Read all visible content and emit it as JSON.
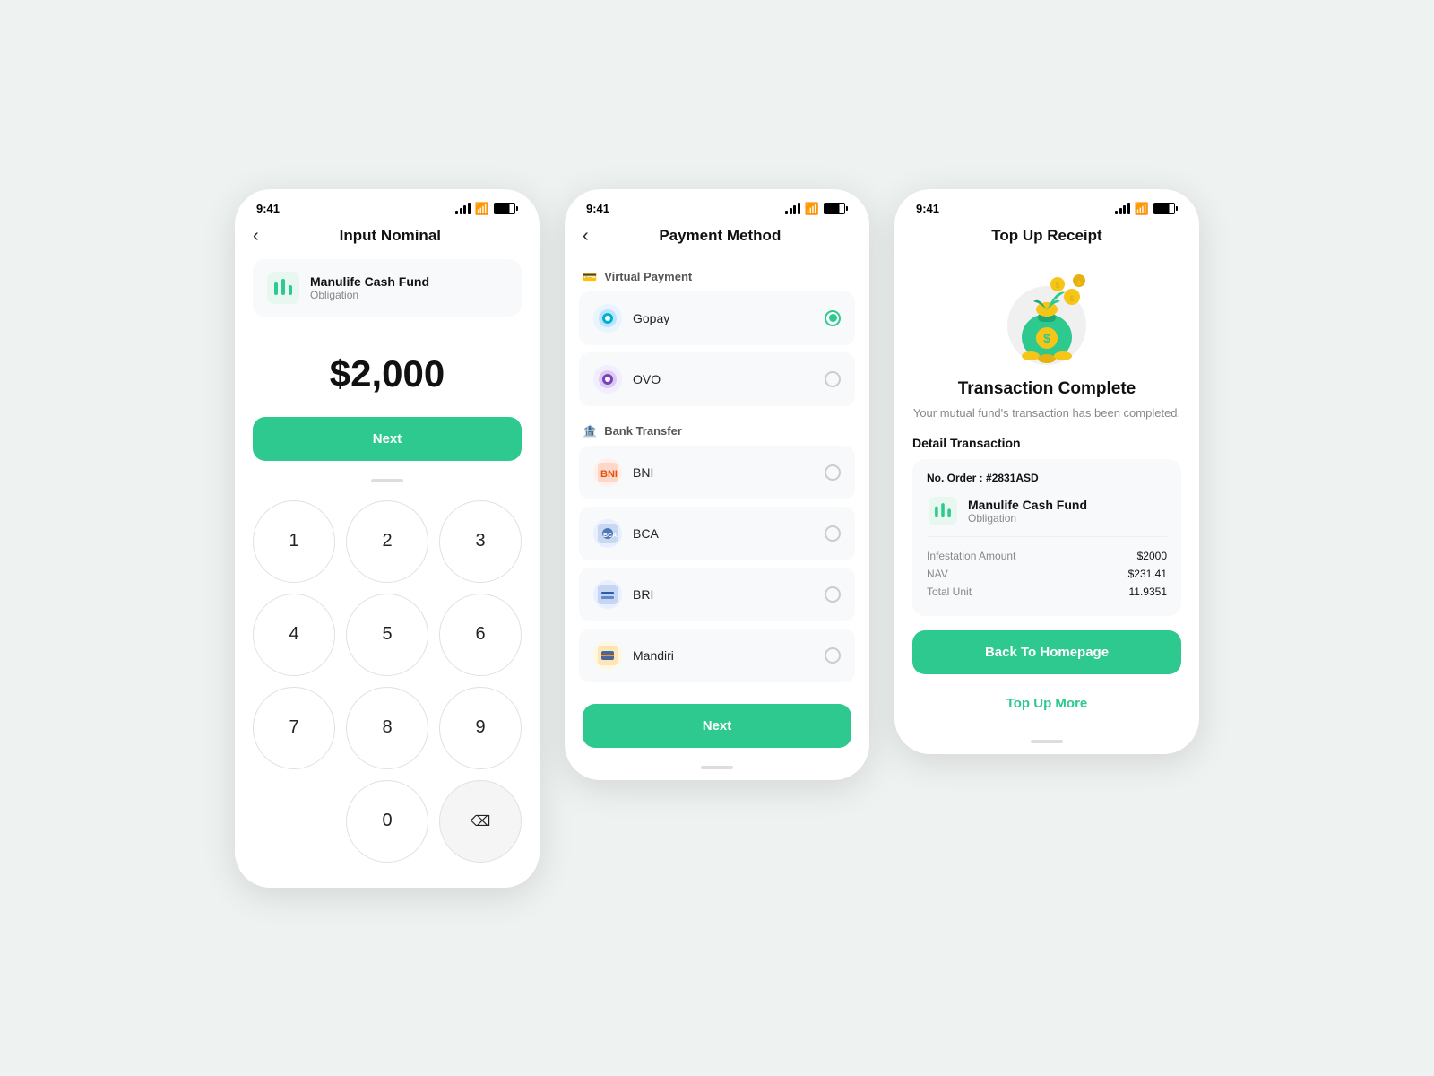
{
  "screens": {
    "screen1": {
      "time": "9:41",
      "title": "Input Nominal",
      "fund_name": "Manulife Cash Fund",
      "fund_type": "Obligation",
      "amount": "$2,000",
      "next_label": "Next",
      "numpad": [
        "1",
        "2",
        "3",
        "4",
        "5",
        "6",
        "7",
        "8",
        "9",
        "0",
        "⌫"
      ]
    },
    "screen2": {
      "time": "9:41",
      "title": "Payment Method",
      "virtual_payment_label": "Virtual Payment",
      "bank_transfer_label": "Bank Transfer",
      "payment_items": [
        {
          "id": "gopay",
          "name": "Gopay",
          "selected": true
        },
        {
          "id": "ovo",
          "name": "OVO",
          "selected": false
        },
        {
          "id": "bni",
          "name": "BNI",
          "selected": false
        },
        {
          "id": "bca",
          "name": "BCA",
          "selected": false
        },
        {
          "id": "bri",
          "name": "BRI",
          "selected": false
        },
        {
          "id": "mandiri",
          "name": "Mandiri",
          "selected": false
        }
      ],
      "next_label": "Next"
    },
    "screen3": {
      "time": "9:41",
      "title": "Top Up Receipt",
      "complete_title": "Transaction Complete",
      "complete_subtitle": "Your mutual fund's transaction has been completed.",
      "detail_title": "Detail Transaction",
      "order_no_label": "No. Order :",
      "order_no_value": "#2831ASD",
      "fund_name": "Manulife Cash Fund",
      "fund_type": "Obligation",
      "rows": [
        {
          "label": "Infestation Amount",
          "value": "$2000"
        },
        {
          "label": "NAV",
          "value": "$231.41"
        },
        {
          "label": "Total Unit",
          "value": "11.9351"
        }
      ],
      "back_home_label": "Back To Homepage",
      "topup_more_label": "Top Up More"
    }
  },
  "colors": {
    "primary": "#2dc98e",
    "bg": "#eef2f0"
  }
}
